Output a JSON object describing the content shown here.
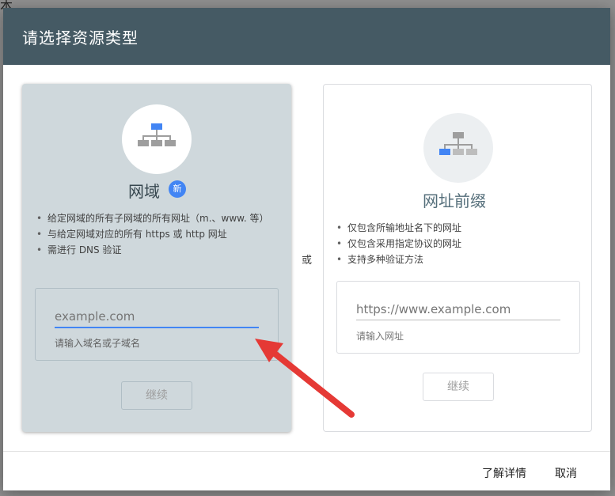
{
  "dialog": {
    "title": "请选择资源类型"
  },
  "domain_card": {
    "icon": "sitemap-icon",
    "title": "网域",
    "badge": "新",
    "bullets": [
      "给定网域的所有子网域的所有网址（m.、www. 等）",
      "与给定网域对应的所有 https 或 http 网址",
      "需进行 DNS 验证"
    ],
    "input_placeholder": "example.com",
    "helper": "请输入域名或子域名",
    "continue": "继续"
  },
  "or_label": "或",
  "prefix_card": {
    "icon": "sitemap-icon",
    "title": "网址前缀",
    "bullets": [
      "仅包含所输地址名下的网址",
      "仅包含采用指定协议的网址",
      "支持多种验证方法"
    ],
    "input_placeholder": "https://www.example.com",
    "helper": "请输入网址",
    "continue": "继续"
  },
  "footer": {
    "learn_more": "了解详情",
    "cancel": "取消"
  },
  "colors": {
    "header": "#455a64",
    "selected_card": "#cfd8dc",
    "accent": "#4285f4",
    "arrow": "#e53935"
  }
}
